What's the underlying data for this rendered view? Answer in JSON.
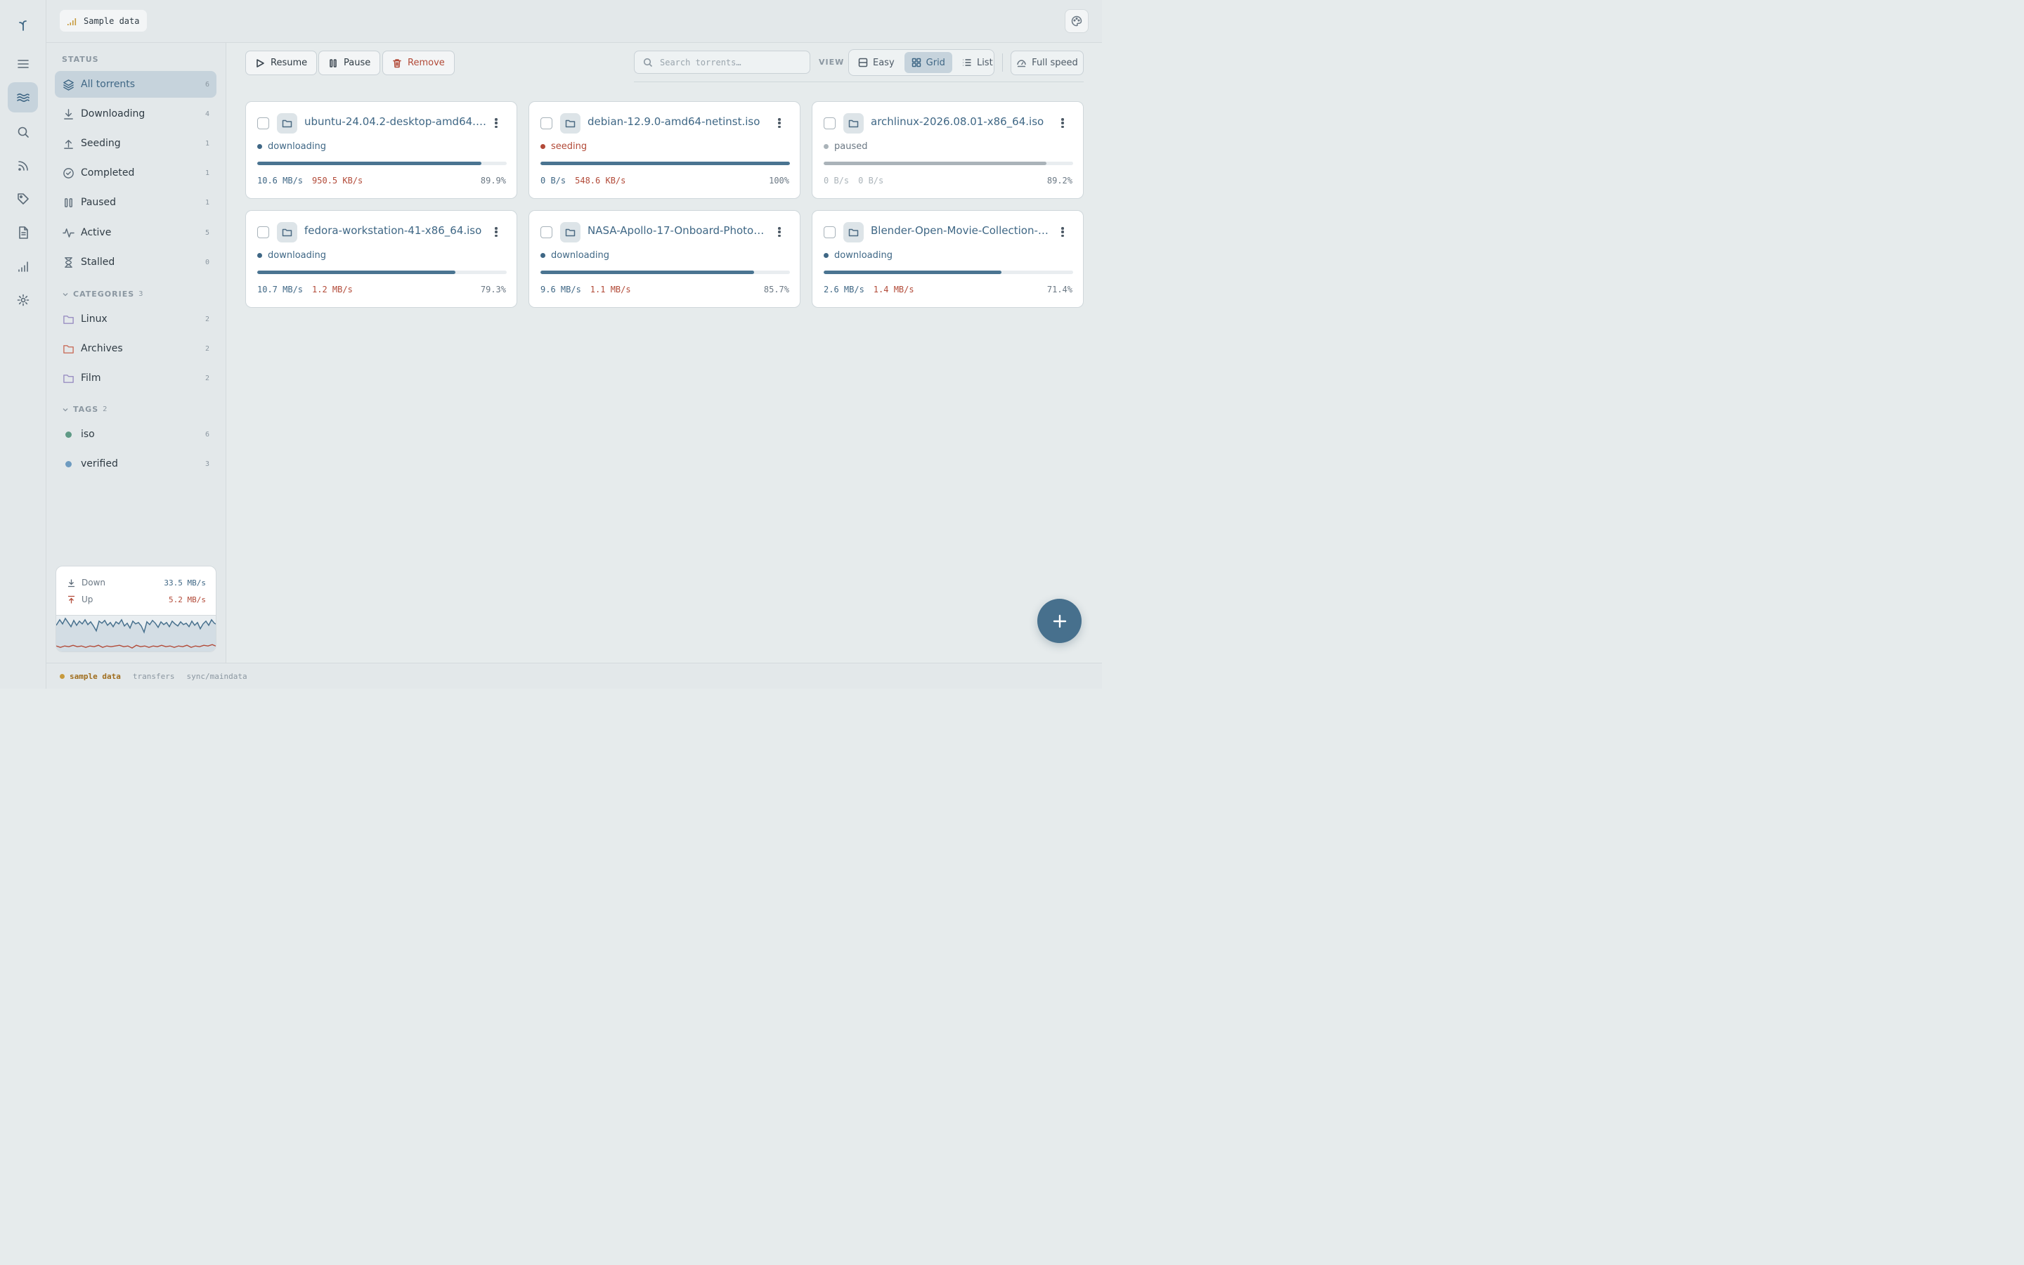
{
  "topbar": {
    "sample_label": "Sample data"
  },
  "sidebar": {
    "status_heading": "STATUS",
    "status_items": [
      {
        "label": "All torrents",
        "count": "6",
        "icon": "layers-icon"
      },
      {
        "label": "Downloading",
        "count": "4",
        "icon": "download-icon"
      },
      {
        "label": "Seeding",
        "count": "1",
        "icon": "upload-icon"
      },
      {
        "label": "Completed",
        "count": "1",
        "icon": "check-circle-icon"
      },
      {
        "label": "Paused",
        "count": "1",
        "icon": "pause-icon"
      },
      {
        "label": "Active",
        "count": "5",
        "icon": "activity-icon"
      },
      {
        "label": "Stalled",
        "count": "0",
        "icon": "hourglass-icon"
      }
    ],
    "categories_heading": "CATEGORIES",
    "categories_count": "3",
    "categories": [
      {
        "label": "Linux",
        "count": "2",
        "color": "#9a8fc2"
      },
      {
        "label": "Archives",
        "count": "2",
        "color": "#c9705e"
      },
      {
        "label": "Film",
        "count": "2",
        "color": "#9a8fc2"
      }
    ],
    "tags_heading": "TAGS",
    "tags_count": "2",
    "tags": [
      {
        "label": "iso",
        "count": "6",
        "color": "#5f9a86"
      },
      {
        "label": "verified",
        "count": "3",
        "color": "#6e9bc0"
      }
    ],
    "speed": {
      "down_label": "Down",
      "down_value": "33.5 MB/s",
      "up_label": "Up",
      "up_value": "5.2 MB/s"
    }
  },
  "toolbar": {
    "resume_label": "Resume",
    "pause_label": "Pause",
    "remove_label": "Remove",
    "search_placeholder": "Search torrents…",
    "view_label": "VIEW",
    "view_options": [
      "Easy",
      "Grid",
      "List"
    ],
    "selected_view": "Grid",
    "fullspeed_label": "Full speed"
  },
  "torrents": [
    {
      "name": "ubuntu-24.04.2-desktop-amd64.iso",
      "state": "downloading",
      "down": "10.6 MB/s",
      "up": "950.5 KB/s",
      "percent": "89.9%",
      "progress": 0.899
    },
    {
      "name": "debian-12.9.0-amd64-netinst.iso",
      "state": "seeding",
      "down": "0 B/s",
      "up": "548.6 KB/s",
      "percent": "100%",
      "progress": 1.0
    },
    {
      "name": "archlinux-2026.08.01-x86_64.iso",
      "state": "paused",
      "down": "0 B/s",
      "up": "0 B/s",
      "percent": "89.2%",
      "progress": 0.892
    },
    {
      "name": "fedora-workstation-41-x86_64.iso",
      "state": "downloading",
      "down": "10.7 MB/s",
      "up": "1.2 MB/s",
      "percent": "79.3%",
      "progress": 0.793
    },
    {
      "name": "NASA-Apollo-17-Onboard-Photog...",
      "state": "downloading",
      "down": "9.6 MB/s",
      "up": "1.1 MB/s",
      "percent": "85.7%",
      "progress": 0.857
    },
    {
      "name": "Blender-Open-Movie-Collection-2...",
      "state": "downloading",
      "down": "2.6 MB/s",
      "up": "1.4 MB/s",
      "percent": "71.4%",
      "progress": 0.714
    }
  ],
  "statusbar": {
    "sample": "sample data",
    "transfers": "transfers",
    "sync": "sync/maindata"
  },
  "colors": {
    "accent": "#3f6785",
    "download": "#3f6785",
    "upload": "#b24a38",
    "seeding_dot": "#b24a38",
    "paused": "#aab3b9",
    "progress": "#4a7491"
  }
}
